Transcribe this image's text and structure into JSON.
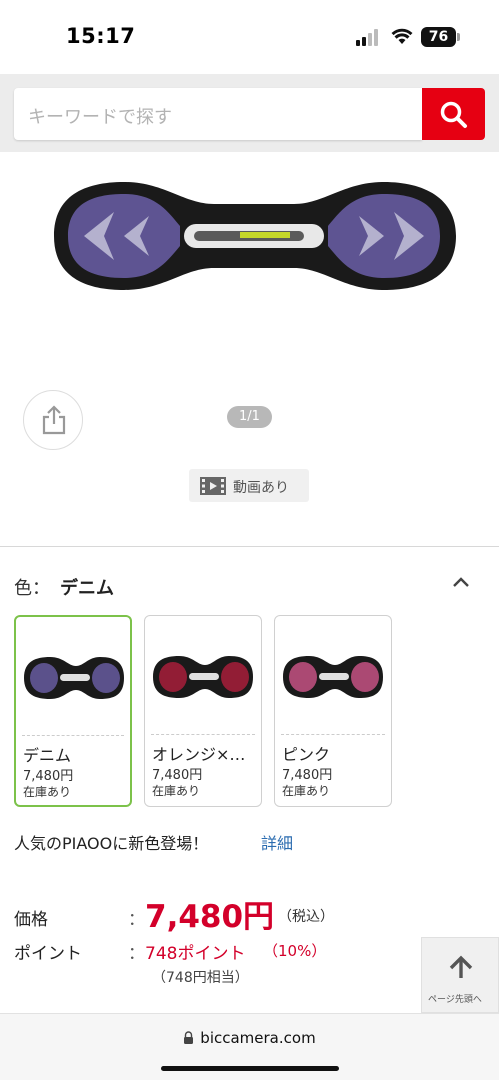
{
  "status_bar": {
    "time": "15:17",
    "battery": "76"
  },
  "search": {
    "placeholder": "キーワードで探す"
  },
  "gallery": {
    "pager": "1/1",
    "video_label": "動画あり"
  },
  "color": {
    "prefix": "色：",
    "selected": "デニム",
    "options": [
      {
        "name": "デニム",
        "price": "7,480円",
        "stock": "在庫あり",
        "accent": "#6b5fa8"
      },
      {
        "name": "オレンジ×…",
        "price": "7,480円",
        "stock": "在庫あり",
        "accent": "#b01e3c"
      },
      {
        "name": "ピンク",
        "price": "7,480円",
        "stock": "在庫あり",
        "accent": "#d0558a"
      }
    ]
  },
  "promo": {
    "text": "人気のPIAOOに新色登場！",
    "link": "詳細"
  },
  "price": {
    "label": "価格",
    "colon": "：",
    "value": "7,480円",
    "tax": "（税込）",
    "point_label": "ポイント",
    "point_value": "748ポイント",
    "point_rate": "（10%）",
    "point_equiv": "（748円相当）"
  },
  "back_to_top": {
    "label": "ページ先頭へ"
  },
  "url_bar": {
    "domain": "biccamera.com"
  },
  "colors": {
    "brand_red": "#e60012",
    "price_red": "#d3002a",
    "selected_green": "#7cc24a",
    "link_blue": "#2b6cb0"
  }
}
